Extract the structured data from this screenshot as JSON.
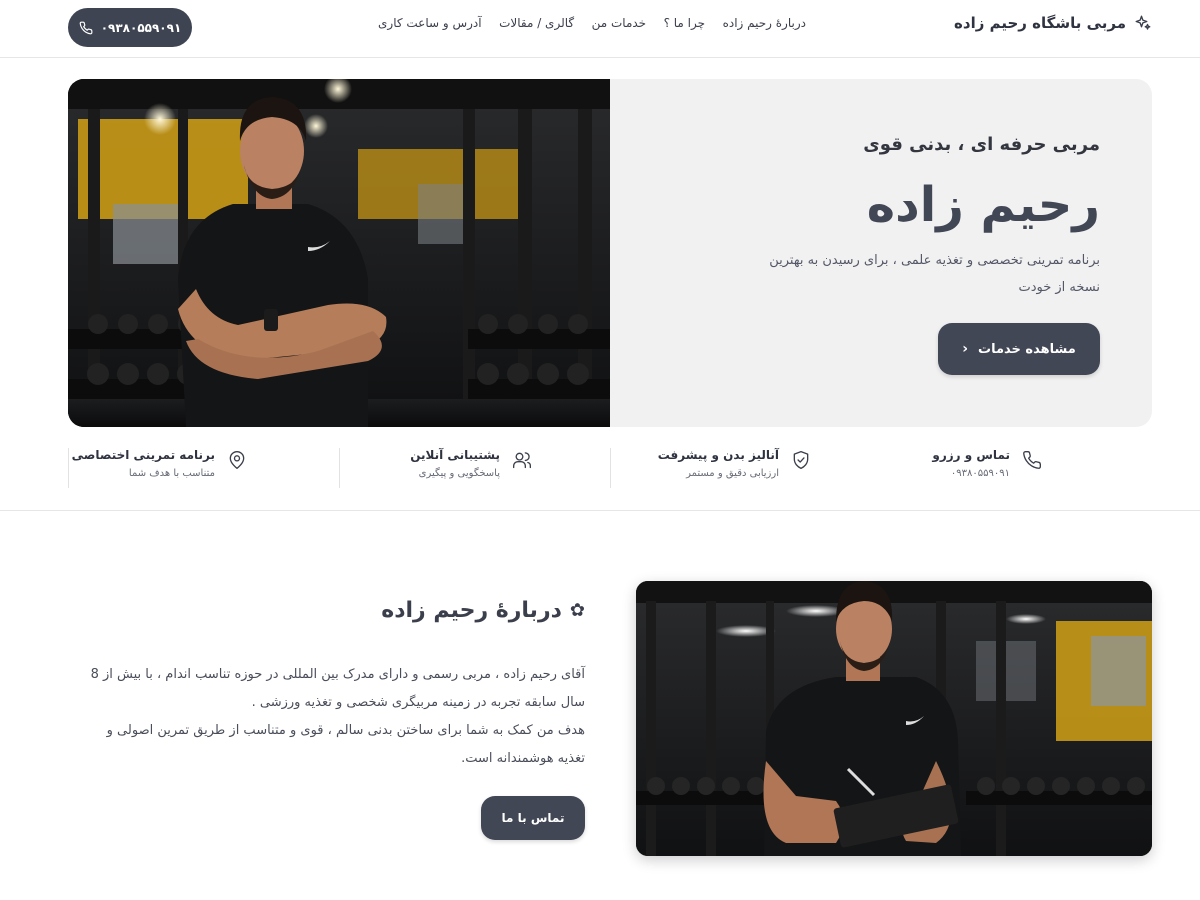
{
  "header": {
    "brand_title": "مربی باشگاه رحیم زاده",
    "nav": [
      {
        "label": "دربارهٔ رحیم زاده"
      },
      {
        "label": "چرا ما ؟"
      },
      {
        "label": "خدمات من"
      },
      {
        "label": "گالری / مقالات"
      },
      {
        "label": "آدرس و ساعت کاری"
      }
    ],
    "phone_button": "۰۹۳۸۰۵۵۹۰۹۱"
  },
  "hero": {
    "subtitle": "مربی حرفه ای ، بدنی قوی",
    "title": "رحیم زاده",
    "description": "برنامه تمرینی تخصصی و تغذیه علمی ، برای رسیدن به بهترین نسخه از خودت",
    "cta_label": "مشاهده خدمات"
  },
  "features": [
    {
      "title": "تماس و رزرو",
      "subtitle": "۰۹۳۸۰۵۵۹۰۹۱",
      "icon": "phone-icon"
    },
    {
      "title": "آنالیز بدن و پیشرفت",
      "subtitle": "ارزیابی دقیق و مستمر",
      "icon": "shield-check-icon"
    },
    {
      "title": "پشتیبانی آنلاین",
      "subtitle": "پاسخگویی و پیگیری",
      "icon": "users-icon"
    },
    {
      "title": "برنامه تمرینی اختصاصی",
      "subtitle": "متناسب با هدف شما",
      "icon": "map-pin-icon"
    }
  ],
  "about": {
    "title": "دربارهٔ رحیم زاده",
    "paragraph1": "آقای رحیم زاده ، مربی رسمی و دارای مدرک بین المللی در حوزه تناسب اندام ، با بیش از 8 سال سابقه تجربه در زمینه مربیگری شخصی و تغذیه ورزشی .",
    "paragraph2": "هدف من کمک به شما برای ساختن بدنی سالم ، قوی و متناسب از طریق تمرین اصولی و تغذیه هوشمندانه است.",
    "contact_label": "تماس با ما"
  },
  "colors": {
    "primary": "#424756",
    "hero_bg": "#f1f1f2",
    "gym_yellow": "#e3b51e",
    "text": "#3b3f4c"
  }
}
